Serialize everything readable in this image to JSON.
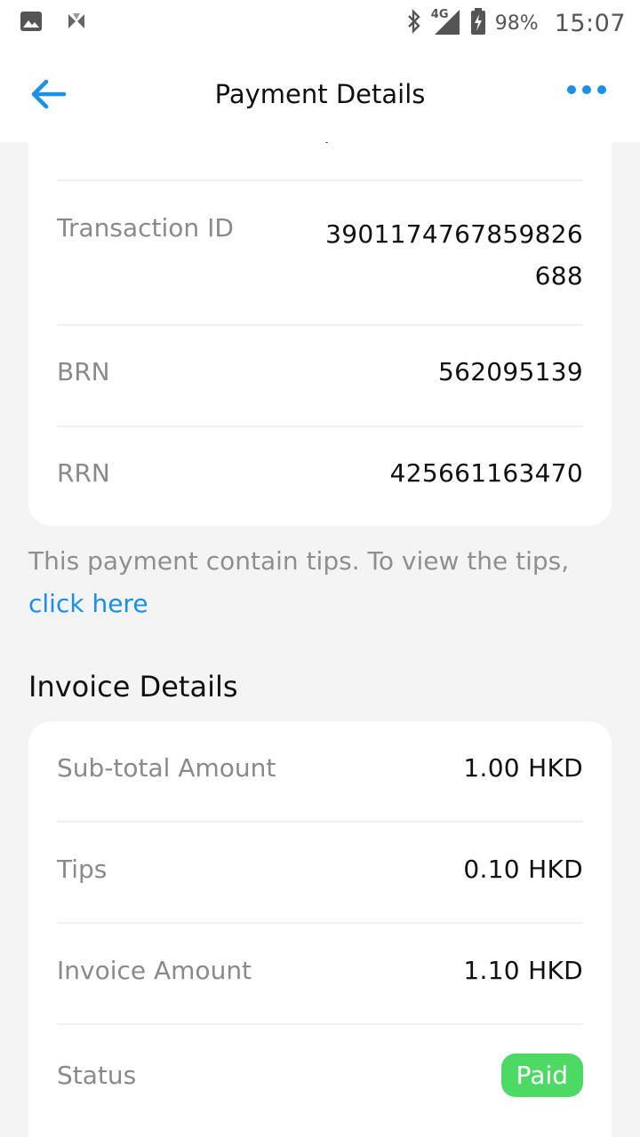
{
  "status_bar": {
    "battery": "98%",
    "time": "15:07",
    "network": "4G",
    "icons": [
      "gallery-icon",
      "app-notification-icon",
      "bluetooth-icon",
      "signal-icon",
      "battery-icon"
    ]
  },
  "header": {
    "title": "Payment Details",
    "back_icon": "arrow-left-icon",
    "more_icon": "more-horizontal-icon",
    "accent_color": "#1a90e8"
  },
  "transaction": {
    "rows": [
      {
        "label": "Transaction ID",
        "value": "3901174767859826688"
      },
      {
        "label": "BRN",
        "value": "562095139"
      },
      {
        "label": "RRN",
        "value": "425661163470"
      }
    ]
  },
  "tips_note": {
    "text": "This payment contain tips. To view the tips, ",
    "link": "click here"
  },
  "invoice": {
    "title": "Invoice Details",
    "rows": [
      {
        "label": "Sub-total Amount",
        "value": "1.00 HKD"
      },
      {
        "label": "Tips",
        "value": "0.10 HKD"
      },
      {
        "label": "Invoice Amount",
        "value": "1.10 HKD"
      }
    ],
    "status": {
      "label": "Status",
      "value": "Paid",
      "color": "#4cd964"
    }
  }
}
